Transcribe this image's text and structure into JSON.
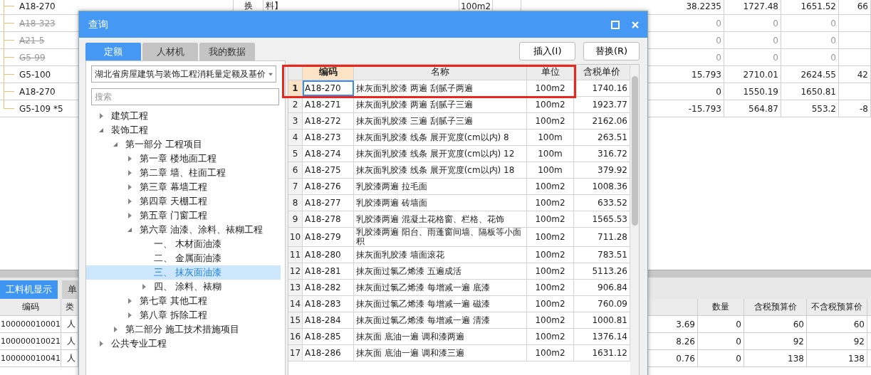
{
  "main_table": {
    "rows": [
      {
        "code": "A18-270",
        "struck": false,
        "column_2": "换",
        "column_3": "料】",
        "unit": "100m2",
        "quantity": "38.2235",
        "price_1": "1727.48",
        "price_2": "1651.52",
        "column_9": "66"
      },
      {
        "code": "A18-323",
        "struck": true,
        "quantity": "0",
        "price_1": "0",
        "price_2": "0"
      },
      {
        "code": "A21-5",
        "struck": true,
        "quantity": "0",
        "price_1": "0",
        "price_2": "0"
      },
      {
        "code": "G5-99",
        "struck": true,
        "quantity": "0",
        "price_1": "0",
        "price_2": "0"
      },
      {
        "code": "G5-100",
        "struck": false,
        "quantity": "15.793",
        "price_1": "2710.01",
        "price_2": "2624.55",
        "column_9": "42"
      },
      {
        "code": "A18-270",
        "struck": false,
        "quantity": "0",
        "price_1": "1550.19",
        "price_2": "1650.81"
      },
      {
        "code": "G5-109 *5",
        "struck": false,
        "quantity": "-15.793",
        "price_1": "564.87",
        "price_2": "553.2",
        "column_9": "-8"
      }
    ]
  },
  "bottom_panel": {
    "tabs": [
      {
        "label": "工料机显示",
        "selected": true
      },
      {
        "label": "单",
        "selected": false
      }
    ],
    "columns": [
      "编码",
      "类",
      "数量",
      "含税预算价",
      "不含税预算价"
    ],
    "rows": [
      {
        "code": "100000010001",
        "type": "人",
        "column_3": "3.69",
        "quantity": "0",
        "tax_price": "60",
        "pre_tax_price": "60"
      },
      {
        "code": "100000010021",
        "type": "人",
        "column_3": "8.26",
        "quantity": "0",
        "tax_price": "92",
        "pre_tax_price": "92"
      },
      {
        "code": "100000010041",
        "type": "人",
        "column_3": "0.76",
        "quantity": "0",
        "tax_price": "138",
        "pre_tax_price": "138"
      }
    ]
  },
  "dialog": {
    "title": "查询",
    "tabs": [
      {
        "label": "定额",
        "selected": true
      },
      {
        "label": "人材机",
        "selected": false
      },
      {
        "label": "我的数据",
        "selected": false
      }
    ],
    "library": "湖北省房屋建筑与装饰工程消耗量定额及基价",
    "search": {
      "placeholder": "搜索"
    },
    "tree": [
      {
        "label": "建筑工程",
        "kind": "branch",
        "expanded": false,
        "selected": false
      },
      {
        "label": "装饰工程",
        "kind": "branch",
        "expanded": true,
        "selected": false,
        "children": [
          {
            "label": "第一部分 工程项目",
            "kind": "branch",
            "expanded": true,
            "selected": false,
            "children": [
              {
                "label": "第一章 楼地面工程",
                "kind": "branch",
                "expanded": false,
                "selected": false
              },
              {
                "label": "第二章 墙、柱面工程",
                "kind": "branch",
                "expanded": false,
                "selected": false
              },
              {
                "label": "第三章 幕墙工程",
                "kind": "branch",
                "expanded": false,
                "selected": false
              },
              {
                "label": "第四章 天棚工程",
                "kind": "branch",
                "expanded": false,
                "selected": false
              },
              {
                "label": "第五章 门窗工程",
                "kind": "branch",
                "expanded": false,
                "selected": false
              },
              {
                "label": "第六章 油漆、涂料、裱糊工程",
                "kind": "branch",
                "expanded": true,
                "selected": false,
                "children": [
                  {
                    "label": "一、 木材面油漆",
                    "kind": "leaf",
                    "selected": false
                  },
                  {
                    "label": "二、 金属面油漆",
                    "kind": "leaf",
                    "selected": false
                  },
                  {
                    "label": "三、 抹灰面油漆",
                    "kind": "leaf",
                    "selected": true
                  },
                  {
                    "label": "四、 涂料、裱糊",
                    "kind": "branch",
                    "expanded": false,
                    "selected": false
                  }
                ]
              },
              {
                "label": "第七章 其他工程",
                "kind": "branch",
                "expanded": false,
                "selected": false
              },
              {
                "label": "第八章 拆除工程",
                "kind": "branch",
                "expanded": false,
                "selected": false
              }
            ]
          },
          {
            "label": "第二部分 施工技术措施项目",
            "kind": "branch",
            "expanded": false,
            "selected": false
          }
        ]
      },
      {
        "label": "公共专业工程",
        "kind": "branch",
        "expanded": false,
        "selected": false
      }
    ],
    "buttons": [
      "插入(I)",
      "替换(R)"
    ],
    "table": {
      "columns": [
        {
          "label": "编码",
          "selected": true
        },
        {
          "label": "名称",
          "selected": false
        },
        {
          "label": "单位",
          "selected": false
        },
        {
          "label": "含税单价",
          "selected": false
        }
      ],
      "rows": [
        {
          "no": "1",
          "code": "A18-270",
          "name": "抹灰面乳胶漆 两遍 刮腻子两遍",
          "unit": "100m2",
          "price": "1740.16",
          "selected": true
        },
        {
          "no": "2",
          "code": "A18-271",
          "name": "抹灰面乳胶漆 两遍 刮腻子三遍",
          "unit": "100m2",
          "price": "1923.77",
          "selected": false
        },
        {
          "no": "3",
          "code": "A18-272",
          "name": "抹灰面乳胶漆 三遍 刮腻子三遍",
          "unit": "100m2",
          "price": "2162.06",
          "selected": false
        },
        {
          "no": "4",
          "code": "A18-273",
          "name": "抹灰面乳胶漆 线条 展开宽度(cm以内) 8",
          "unit": "100m",
          "price": "263.51",
          "selected": false
        },
        {
          "no": "5",
          "code": "A18-274",
          "name": "抹灰面乳胶漆 线条 展开宽度(cm以内) 12",
          "unit": "100m",
          "price": "316.72",
          "selected": false
        },
        {
          "no": "6",
          "code": "A18-275",
          "name": "抹灰面乳胶漆 线条 展开宽度(cm以内) 18",
          "unit": "100m",
          "price": "379.92",
          "selected": false
        },
        {
          "no": "7",
          "code": "A18-276",
          "name": "乳胶漆两遍 拉毛面",
          "unit": "100m2",
          "price": "1008.36",
          "selected": false
        },
        {
          "no": "8",
          "code": "A18-277",
          "name": "乳胶漆两遍 砖墙面",
          "unit": "100m2",
          "price": "633.52",
          "selected": false
        },
        {
          "no": "9",
          "code": "A18-278",
          "name": "乳胶漆两遍 混凝土花格窗、栏格、花饰",
          "unit": "100m2",
          "price": "1565.53",
          "selected": false
        },
        {
          "no": "10",
          "code": "A18-279",
          "name": "乳胶漆两遍 阳台、雨蓬窗间墙、隔板等小面积",
          "unit": "100m2",
          "price": "711.28",
          "selected": false
        },
        {
          "no": "11",
          "code": "A18-280",
          "name": "抹灰面乳胶漆 墙面滚花",
          "unit": "100m2",
          "price": "783.51",
          "selected": false
        },
        {
          "no": "12",
          "code": "A18-281",
          "name": "抹灰面过氯乙烯漆 五遍成活",
          "unit": "100m2",
          "price": "5113.26",
          "selected": false
        },
        {
          "no": "13",
          "code": "A18-282",
          "name": "抹灰面过氯乙烯漆 每增减一遍 底漆",
          "unit": "100m2",
          "price": "906.84",
          "selected": false
        },
        {
          "no": "14",
          "code": "A18-283",
          "name": "抹灰面过氯乙烯漆 每增减一遍 磁漆",
          "unit": "100m2",
          "price": "760.09",
          "selected": false
        },
        {
          "no": "15",
          "code": "A18-284",
          "name": "抹灰面过氯乙烯漆 每增减一遍 清漆",
          "unit": "100m2",
          "price": "1000.81",
          "selected": false
        },
        {
          "no": "16",
          "code": "A18-285",
          "name": "抹灰面 底油一遍 调和漆两遍",
          "unit": "100m2",
          "price": "1376.14",
          "selected": false
        },
        {
          "no": "17",
          "code": "A18-286",
          "name": "抹灰面 底油一遍 调和漆三遍",
          "unit": "100m2",
          "price": "1631.12",
          "selected": false
        }
      ]
    }
  }
}
